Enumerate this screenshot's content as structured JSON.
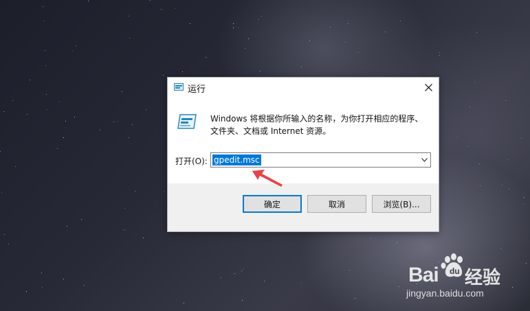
{
  "dialog": {
    "title": "运行",
    "description": "Windows 将根据你所输入的名称，为你打开相应的程序、文件夹、文档或 Internet 资源。",
    "open_label": "打开(O):",
    "open_value": "gpedit.msc",
    "buttons": {
      "ok": "确定",
      "cancel": "取消",
      "browse": "浏览(B)..."
    }
  },
  "watermark": {
    "brand": "Bai",
    "brand_cn": "经验",
    "url": "jingyan.baidu.com"
  },
  "colors": {
    "accent": "#0078d7",
    "annotation_arrow": "#e8434a"
  },
  "icons": {
    "title": "run-icon",
    "close": "close-icon",
    "content": "run-large-icon",
    "dropdown": "chevron-down-icon",
    "annotation": "arrow-annotation"
  }
}
